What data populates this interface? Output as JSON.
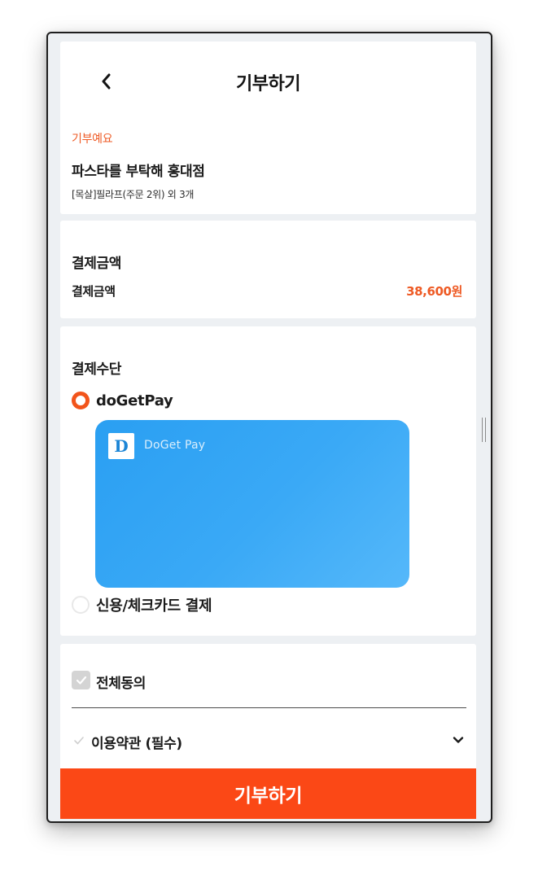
{
  "header": {
    "title": "기부하기",
    "back_icon": "chevron-left-icon"
  },
  "donation": {
    "status": "기부예요",
    "store_name": "파스타를 부탁해 홍대점",
    "order_summary": "[목살]필라프(주문 2위) 외 3개"
  },
  "amount_section": {
    "title": "결제금액",
    "label": "결제금액",
    "value": "38,600원"
  },
  "method_section": {
    "title": "결제수단",
    "options": [
      {
        "label": "doGetPay",
        "selected": true
      },
      {
        "label": "신용/체크카드 결제",
        "selected": false
      }
    ],
    "pay_card": {
      "logo_letter": "D",
      "brand": "DoGet Pay"
    }
  },
  "agreement": {
    "all_label": "전체동의",
    "all_checked": true,
    "terms": [
      {
        "label": "이용약관 (필수)",
        "checked": false,
        "icon": "chevron-down-icon"
      }
    ]
  },
  "submit": {
    "label": "기부하기"
  },
  "colors": {
    "accent": "#fb4816",
    "accent_text": "#ee5a24",
    "card_blue": "#2a9ff2",
    "background": "#edf0f3"
  }
}
